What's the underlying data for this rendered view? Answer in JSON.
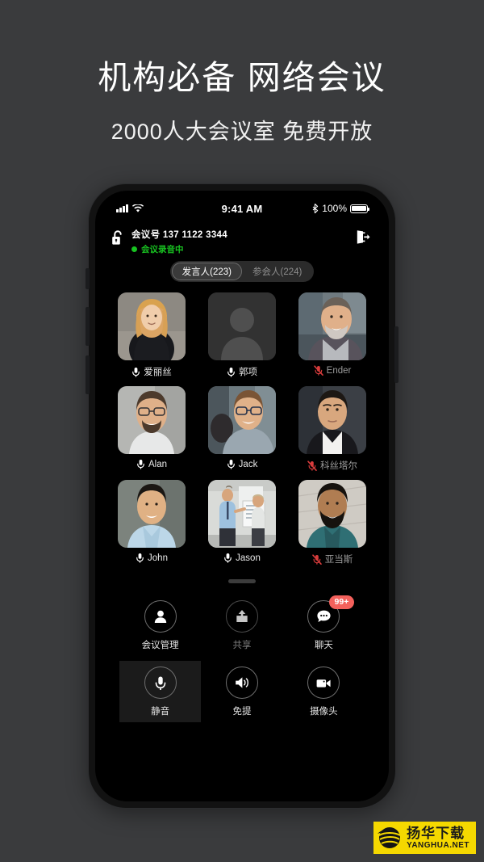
{
  "promo": {
    "title": "机构必备 网络会议",
    "subtitle": "2000人大会议室 免费开放"
  },
  "statusbar": {
    "time": "9:41 AM",
    "battery_percent": "100%",
    "signal_icon": "signal-bars-icon",
    "wifi_icon": "wifi-icon",
    "bluetooth_icon": "bluetooth-icon",
    "battery_icon": "battery-full-icon"
  },
  "meeting": {
    "lock_icon": "unlocked-padlock-icon",
    "id_label": "会议号",
    "id_value": "137 1122 3344",
    "id_full": "会议号  137 1122 3344",
    "recording_text": "会议录音中",
    "recording_color": "#18c321",
    "exit_icon": "exit-meeting-icon"
  },
  "tabs": [
    {
      "label": "发言人(223)",
      "active": true
    },
    {
      "label": "参会人(224)",
      "active": false
    }
  ],
  "participants": [
    {
      "name": "爱丽丝",
      "muted": false,
      "avatar": "woman-blonde"
    },
    {
      "name": "郭项",
      "muted": false,
      "avatar": "placeholder"
    },
    {
      "name": "Ender",
      "muted": true,
      "avatar": "man-beard-gray"
    },
    {
      "name": "Alan",
      "muted": false,
      "avatar": "man-glasses"
    },
    {
      "name": "Jack",
      "muted": false,
      "avatar": "man-glasses-blue"
    },
    {
      "name": "科丝塔尔",
      "muted": true,
      "avatar": "man-suit-dark"
    },
    {
      "name": "John",
      "muted": false,
      "avatar": "man-asian-shirt"
    },
    {
      "name": "Jason",
      "muted": false,
      "avatar": "presentation-board"
    },
    {
      "name": "亚当斯",
      "muted": true,
      "avatar": "man-beard-teal"
    }
  ],
  "controls": {
    "row1": [
      {
        "label": "会议管理",
        "icon": "person-icon",
        "state": "normal",
        "badge": null
      },
      {
        "label": "共享",
        "icon": "share-upload-icon",
        "state": "dim",
        "badge": null
      },
      {
        "label": "聊天",
        "icon": "chat-bubble-icon",
        "state": "normal",
        "badge": "99+"
      }
    ],
    "row2": [
      {
        "label": "静音",
        "icon": "microphone-icon",
        "state": "active",
        "badge": null
      },
      {
        "label": "免提",
        "icon": "speaker-icon",
        "state": "normal",
        "badge": null
      },
      {
        "label": "摄像头",
        "icon": "video-camera-icon",
        "state": "normal",
        "badge": null
      }
    ]
  },
  "colors": {
    "page_background": "#3a3b3d",
    "screen_background": "#000000",
    "badge_red": "#f4615c",
    "recording_green": "#18c321",
    "muted_mic_red": "#d93c3c",
    "watermark_yellow": "#f5d800"
  },
  "watermark": {
    "cn": "扬华下载",
    "en": "YANGHUA.NET",
    "logo_icon": "globe-swoosh-icon"
  }
}
